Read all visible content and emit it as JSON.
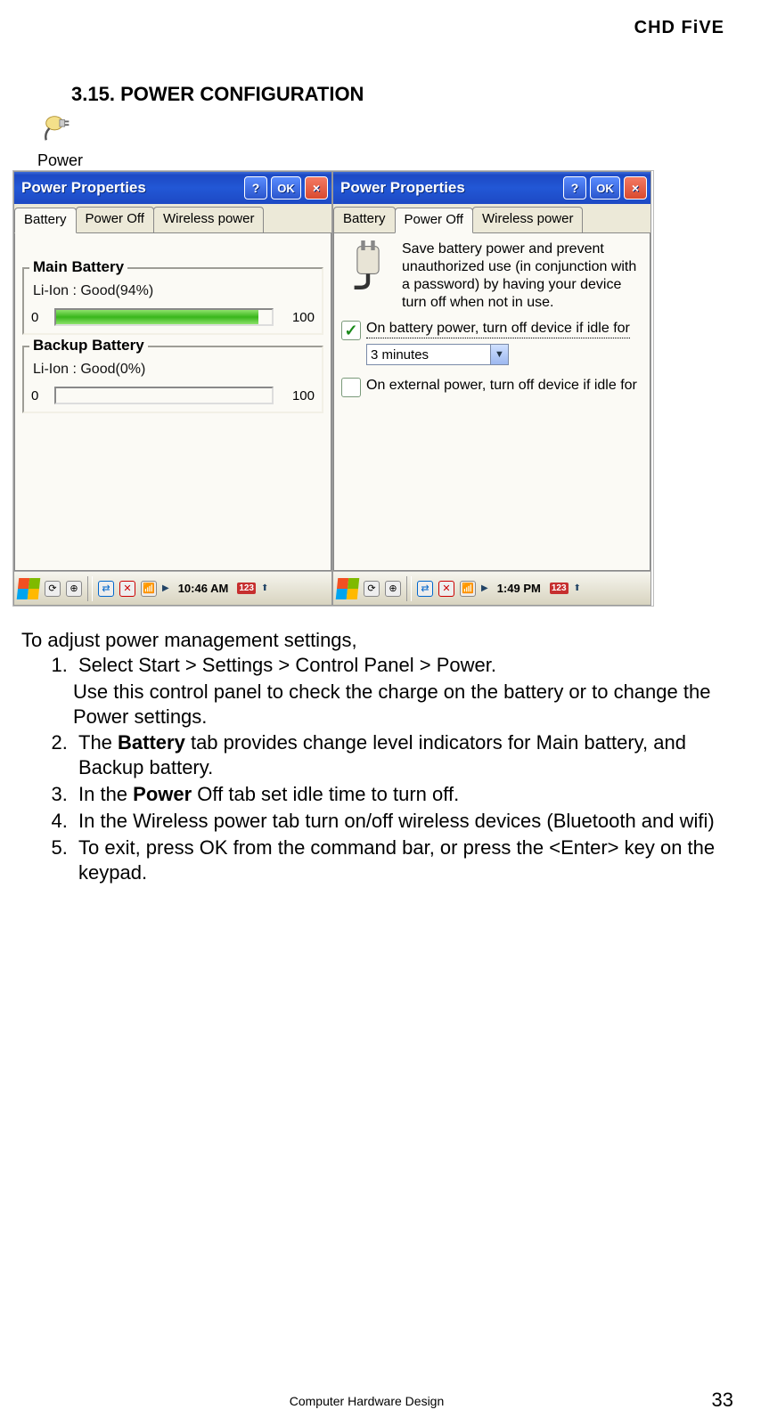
{
  "brand": "CHD FiVE",
  "section_number": "3.15.",
  "section_title_prefix": "P",
  "section_title_rest": "OWER ",
  "section_title_prefix2": "C",
  "section_title_rest2": "ONFIGURATION",
  "power_icon_label": "Power",
  "win1": {
    "title": "Power Properties",
    "help": "?",
    "ok": "OK",
    "close": "×",
    "tabs": {
      "battery": "Battery",
      "poweroff": "Power Off",
      "wireless": "Wireless power"
    },
    "main_legend": "Main Battery",
    "main_status": "Li-Ion : Good(94%)",
    "main_min": "0",
    "main_max": "100",
    "main_fill_pct": 94,
    "backup_legend": "Backup Battery",
    "backup_status": "Li-Ion : Good(0%)",
    "backup_min": "0",
    "backup_max": "100",
    "backup_fill_pct": 0,
    "time": "10:46 AM"
  },
  "win2": {
    "title": "Power Properties",
    "help": "?",
    "ok": "OK",
    "close": "×",
    "tabs": {
      "battery": "Battery",
      "poweroff": "Power Off",
      "wireless": "Wireless power"
    },
    "desc": "Save battery power and prevent unauthorized use (in conjunction with a password) by having your device turn off when not in use.",
    "check1_checked": true,
    "check1_label": "On battery power, turn off device if idle for",
    "combo_value": "3 minutes",
    "check2_checked": false,
    "check2_label": "On external power, turn off device if idle for",
    "time": "1:49 PM"
  },
  "instructions": {
    "intro": "To adjust power management settings,",
    "item1": "Select Start > Settings > Control Panel > Power.",
    "sub1": "Use this control panel to check the charge on the battery or to change the Power settings.",
    "item2a": "The ",
    "item2b_bold": "Battery",
    "item2c": " tab provides change level indicators for Main battery, and Backup battery.",
    "item3a": "In the ",
    "item3b_bold": "Power",
    "item3c": " Off tab set idle time to turn off.",
    "item4": "In the Wireless power tab turn on/off wireless devices (Bluetooth and wifi)",
    "item5": "To exit, press OK from the command bar, or press the <Enter> key on the keypad."
  },
  "footer_center": "Computer Hardware Design",
  "footer_page": "33"
}
